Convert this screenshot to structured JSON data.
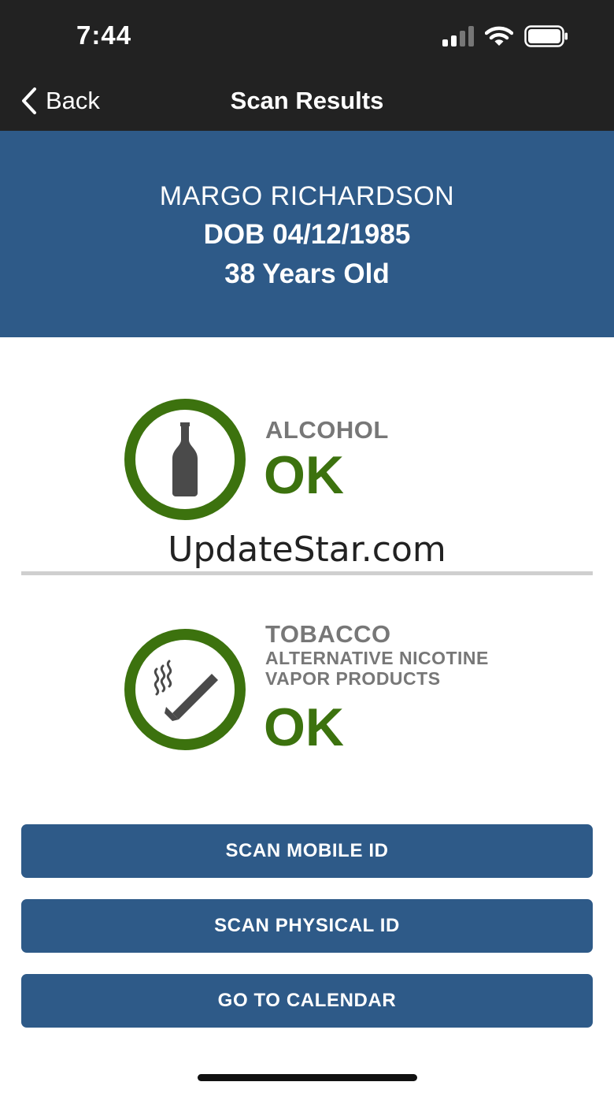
{
  "status_bar": {
    "time": "7:44"
  },
  "nav": {
    "back_label": "Back",
    "title": "Scan Results"
  },
  "id_card": {
    "name": "MARGO RICHARDSON",
    "dob": "DOB 04/12/1985",
    "age": "38 Years Old"
  },
  "alcohol": {
    "title": "ALCOHOL",
    "status": "OK",
    "icon": "bottle-icon"
  },
  "watermark": "UpdateStar.com",
  "tobacco": {
    "title": "TOBACCO",
    "subtitle_line1": "ALTERNATIVE NICOTINE",
    "subtitle_line2": "VAPOR PRODUCTS",
    "status": "OK",
    "icon": "cigarette-icon"
  },
  "buttons": {
    "scan_mobile": "SCAN MOBILE ID",
    "scan_physical": "SCAN PHYSICAL ID",
    "calendar": "GO TO CALENDAR"
  },
  "colors": {
    "header": "#222222",
    "banner": "#2e5a88",
    "ok_green": "#3c720e",
    "label_gray": "#777777"
  }
}
